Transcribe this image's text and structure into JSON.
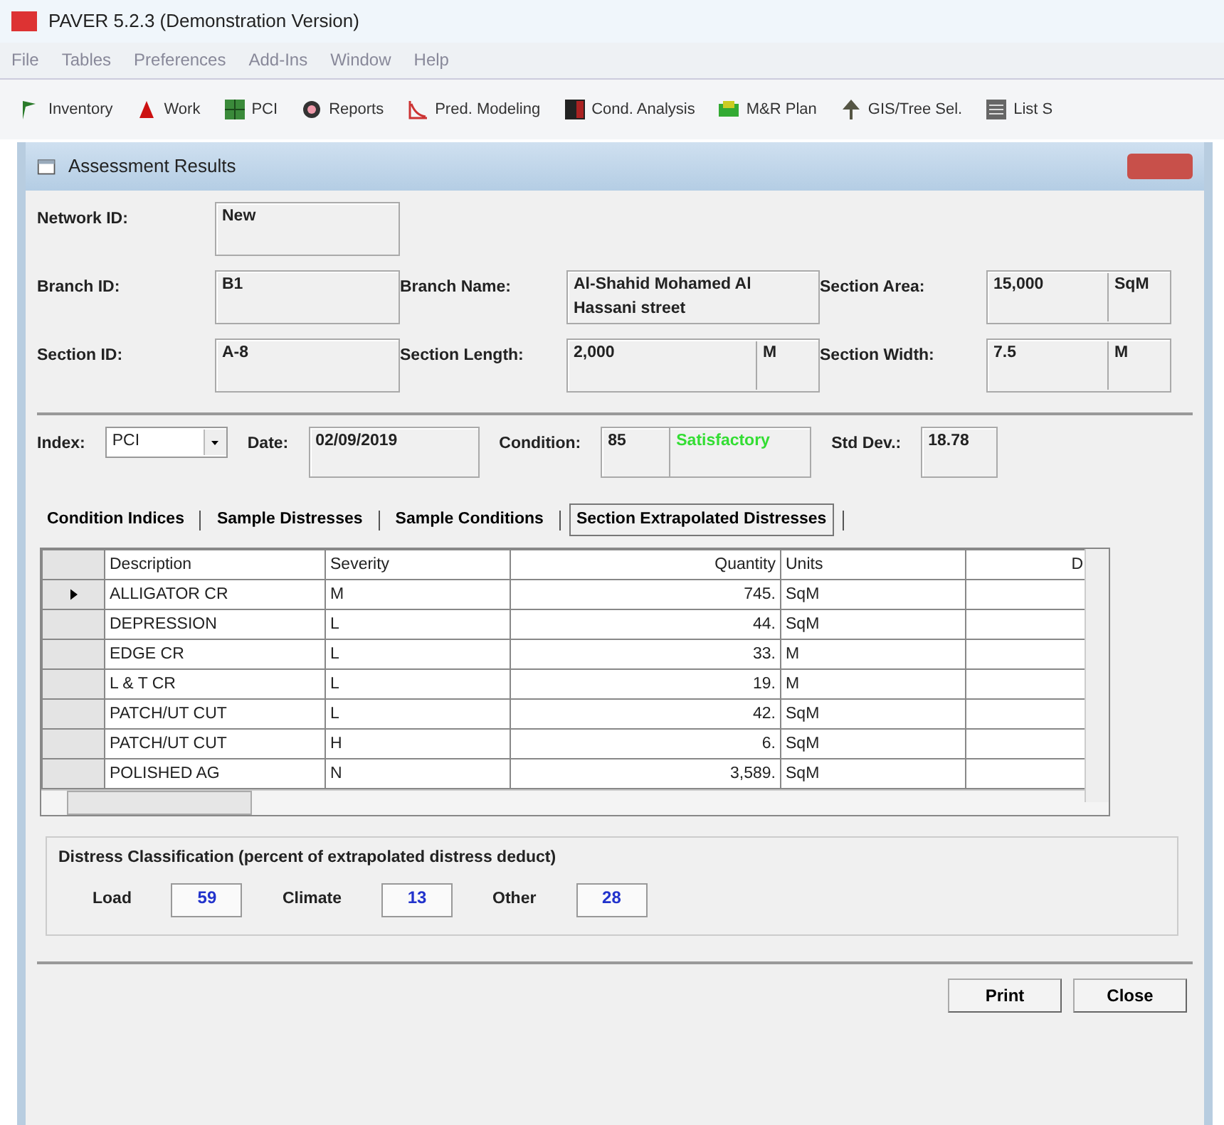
{
  "app": {
    "title": "PAVER 5.2.3 (Demonstration Version)"
  },
  "menu": [
    "File",
    "Tables",
    "Preferences",
    "Add-Ins",
    "Window",
    "Help"
  ],
  "toolbar": [
    {
      "label": "Inventory"
    },
    {
      "label": "Work"
    },
    {
      "label": "PCI"
    },
    {
      "label": "Reports"
    },
    {
      "label": "Pred. Modeling"
    },
    {
      "label": "Cond. Analysis"
    },
    {
      "label": "M&R Plan"
    },
    {
      "label": "GIS/Tree Sel."
    },
    {
      "label": "List S"
    }
  ],
  "dialog": {
    "title": "Assessment Results",
    "network_id": {
      "label": "Network ID:",
      "value": "New"
    },
    "branch_id": {
      "label": "Branch ID:",
      "value": "B1"
    },
    "branch_name": {
      "label": "Branch Name:",
      "value": "Al-Shahid Mohamed Al Hassani street"
    },
    "section_area": {
      "label": "Section Area:",
      "value": "15,000",
      "unit": "SqM"
    },
    "section_id": {
      "label": "Section ID:",
      "value": "A-8"
    },
    "section_length": {
      "label": "Section Length:",
      "value": "2,000",
      "unit": "M"
    },
    "section_width": {
      "label": "Section Width:",
      "value": "7.5",
      "unit": "M"
    },
    "index": {
      "label": "Index:",
      "value": "PCI"
    },
    "date": {
      "label": "Date:",
      "value": "02/09/2019"
    },
    "condition": {
      "label": "Condition:",
      "value": "85",
      "rating": "Satisfactory"
    },
    "std_dev": {
      "label": "Std Dev.:",
      "value": "18.78"
    },
    "tabs": [
      {
        "label": "Condition Indices",
        "selected": false
      },
      {
        "label": "Sample Distresses",
        "selected": false
      },
      {
        "label": "Sample Conditions",
        "selected": false
      },
      {
        "label": "Section Extrapolated Distresses",
        "selected": true
      }
    ],
    "table": {
      "columns": [
        "Description",
        "Severity",
        "Quantity",
        "Units",
        "D"
      ],
      "rows": [
        {
          "current": true,
          "cells": [
            "ALLIGATOR CR",
            "M",
            "745.",
            "SqM",
            ""
          ]
        },
        {
          "current": false,
          "cells": [
            "DEPRESSION",
            "L",
            "44.",
            "SqM",
            ""
          ]
        },
        {
          "current": false,
          "cells": [
            "EDGE CR",
            "L",
            "33.",
            "M",
            ""
          ]
        },
        {
          "current": false,
          "cells": [
            "L & T CR",
            "L",
            "19.",
            "M",
            ""
          ]
        },
        {
          "current": false,
          "cells": [
            "PATCH/UT CUT",
            "L",
            "42.",
            "SqM",
            ""
          ]
        },
        {
          "current": false,
          "cells": [
            "PATCH/UT CUT",
            "H",
            "6.",
            "SqM",
            ""
          ]
        },
        {
          "current": false,
          "cells": [
            "POLISHED AG",
            "N",
            "3,589.",
            "SqM",
            ""
          ]
        }
      ]
    },
    "classification": {
      "title": "Distress Classification (percent of extrapolated distress deduct)",
      "items": [
        {
          "label": "Load",
          "value": "59"
        },
        {
          "label": "Climate",
          "value": "13"
        },
        {
          "label": "Other",
          "value": "28"
        }
      ]
    },
    "buttons": [
      "Print",
      "Close"
    ]
  }
}
